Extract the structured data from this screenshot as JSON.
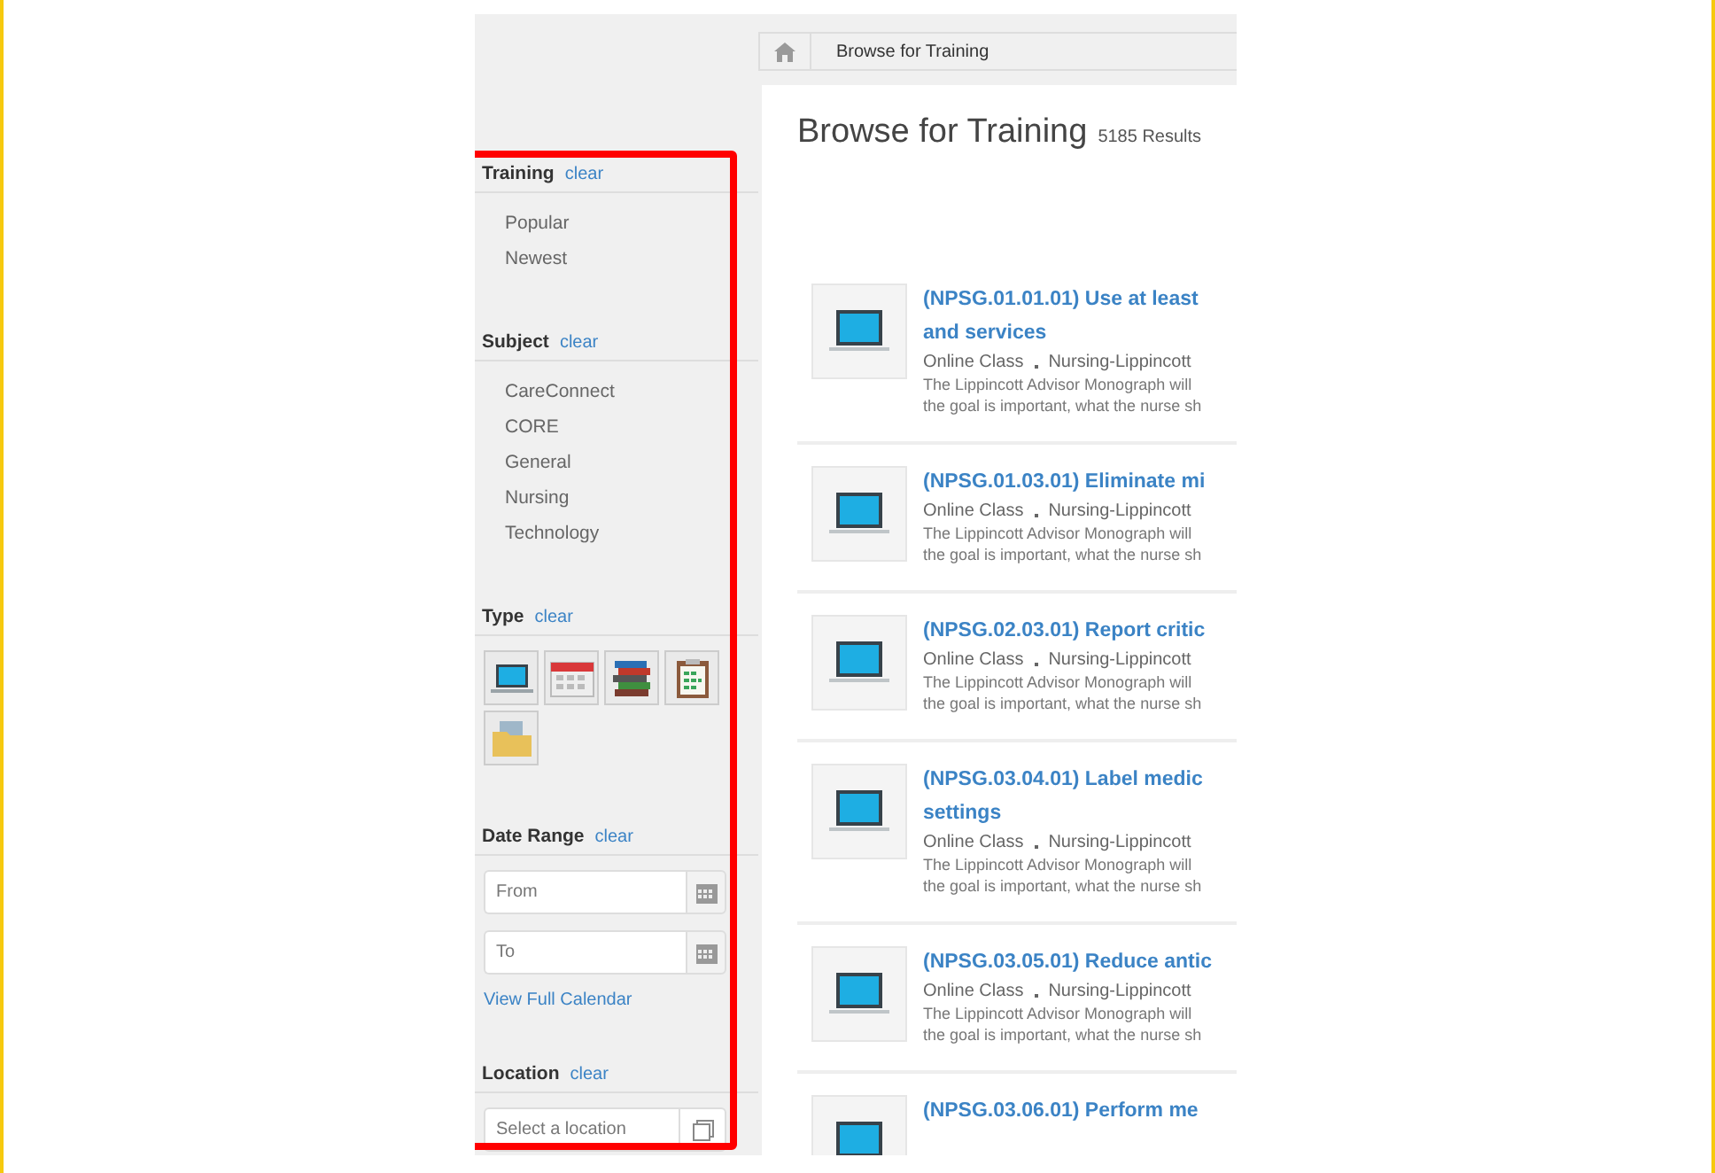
{
  "breadcrumb": {
    "current": "Browse for Training"
  },
  "sidebar": {
    "sections": [
      {
        "kind": "list",
        "title": "Training",
        "clear": "clear",
        "items": [
          "Popular",
          "Newest"
        ]
      },
      {
        "kind": "list",
        "title": "Subject",
        "clear": "clear",
        "items": [
          "CareConnect",
          "CORE",
          "General",
          "Nursing",
          "Technology"
        ]
      },
      {
        "kind": "types",
        "title": "Type",
        "clear": "clear",
        "types": [
          {
            "kind": "laptop"
          },
          {
            "kind": "calendar"
          },
          {
            "kind": "books"
          },
          {
            "kind": "clipboard"
          },
          {
            "kind": "folder"
          }
        ]
      },
      {
        "kind": "dates",
        "title": "Date Range",
        "clear": "clear",
        "from_placeholder": "From",
        "to_placeholder": "To",
        "link": "View Full Calendar"
      },
      {
        "kind": "location",
        "title": "Location",
        "clear": "clear",
        "placeholder": "Select a location"
      }
    ]
  },
  "main": {
    "title": "Browse for Training",
    "count": "5185 Results",
    "results": [
      {
        "title_lines": [
          "(NPSG.01.01.01) Use at least",
          "and services"
        ],
        "type": "Online Class",
        "provider": "Nursing-Lippincott",
        "description_lines": [
          "The Lippincott Advisor Monograph will",
          "the goal is important, what the nurse sh"
        ]
      },
      {
        "title_lines": [
          "(NPSG.01.03.01) Eliminate mi"
        ],
        "type": "Online Class",
        "provider": "Nursing-Lippincott",
        "description_lines": [
          "The Lippincott Advisor Monograph will",
          "the goal is important, what the nurse sh"
        ]
      },
      {
        "title_lines": [
          "(NPSG.02.03.01) Report critic"
        ],
        "type": "Online Class",
        "provider": "Nursing-Lippincott",
        "description_lines": [
          "The Lippincott Advisor Monograph will",
          "the goal is important, what the nurse sh"
        ]
      },
      {
        "title_lines": [
          "(NPSG.03.04.01) Label medic",
          "settings"
        ],
        "type": "Online Class",
        "provider": "Nursing-Lippincott",
        "description_lines": [
          "The Lippincott Advisor Monograph will",
          "the goal is important, what the nurse sh"
        ]
      },
      {
        "title_lines": [
          "(NPSG.03.05.01) Reduce antic"
        ],
        "type": "Online Class",
        "provider": "Nursing-Lippincott",
        "description_lines": [
          "The Lippincott Advisor Monograph will",
          "the goal is important, what the nurse sh"
        ]
      },
      {
        "title_lines": [
          "(NPSG.03.06.01) Perform me"
        ]
      }
    ]
  }
}
